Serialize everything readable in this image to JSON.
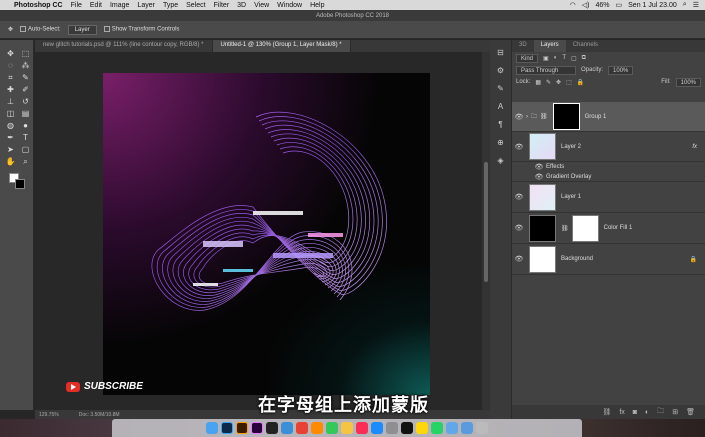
{
  "menubar": {
    "app_name": "Photoshop CC",
    "items": [
      "File",
      "Edit",
      "Image",
      "Layer",
      "Type",
      "Select",
      "Filter",
      "3D",
      "View",
      "Window",
      "Help"
    ],
    "battery": "46%",
    "datetime": "Sen 1 Jul 23.00"
  },
  "window_title": "Adobe Photoshop CC 2018",
  "options": {
    "auto_select_label": "Auto-Select:",
    "auto_select_value": "Layer",
    "show_transform_label": "Show Transform Controls"
  },
  "doc_tabs": [
    {
      "label": "new glitch tutorials.psd @ 111% (line contour copy, RGB/8) *"
    },
    {
      "label": "Untitled-1 @ 130% (Group 1, Layer Mask/8) *"
    }
  ],
  "status": {
    "zoom": "129.75%",
    "doc": "Doc: 3.50M/10.8M"
  },
  "layers_panel": {
    "tabs": [
      "3D",
      "Layers",
      "Channels"
    ],
    "kind_label": "Kind",
    "blend_mode": "Pass Through",
    "opacity_label": "Opacity:",
    "opacity_value": "100%",
    "lock_label": "Lock:",
    "fill_label": "Fill:",
    "fill_value": "100%",
    "layers": [
      {
        "name": "Group 1"
      },
      {
        "name": "Layer 2",
        "fx": "fx",
        "effects_label": "Effects",
        "effect": "Gradient Overlay"
      },
      {
        "name": "Layer 1"
      },
      {
        "name": "Color Fill 1"
      },
      {
        "name": "Background"
      }
    ]
  },
  "overlay": {
    "subscribe": "SUBSCRIBE",
    "subtitle": "在字母组上添加蒙版"
  },
  "colors": {
    "accent_purple": "#7a1f6a",
    "teal": "#0e5a55",
    "youtube_red": "#e52d27"
  }
}
